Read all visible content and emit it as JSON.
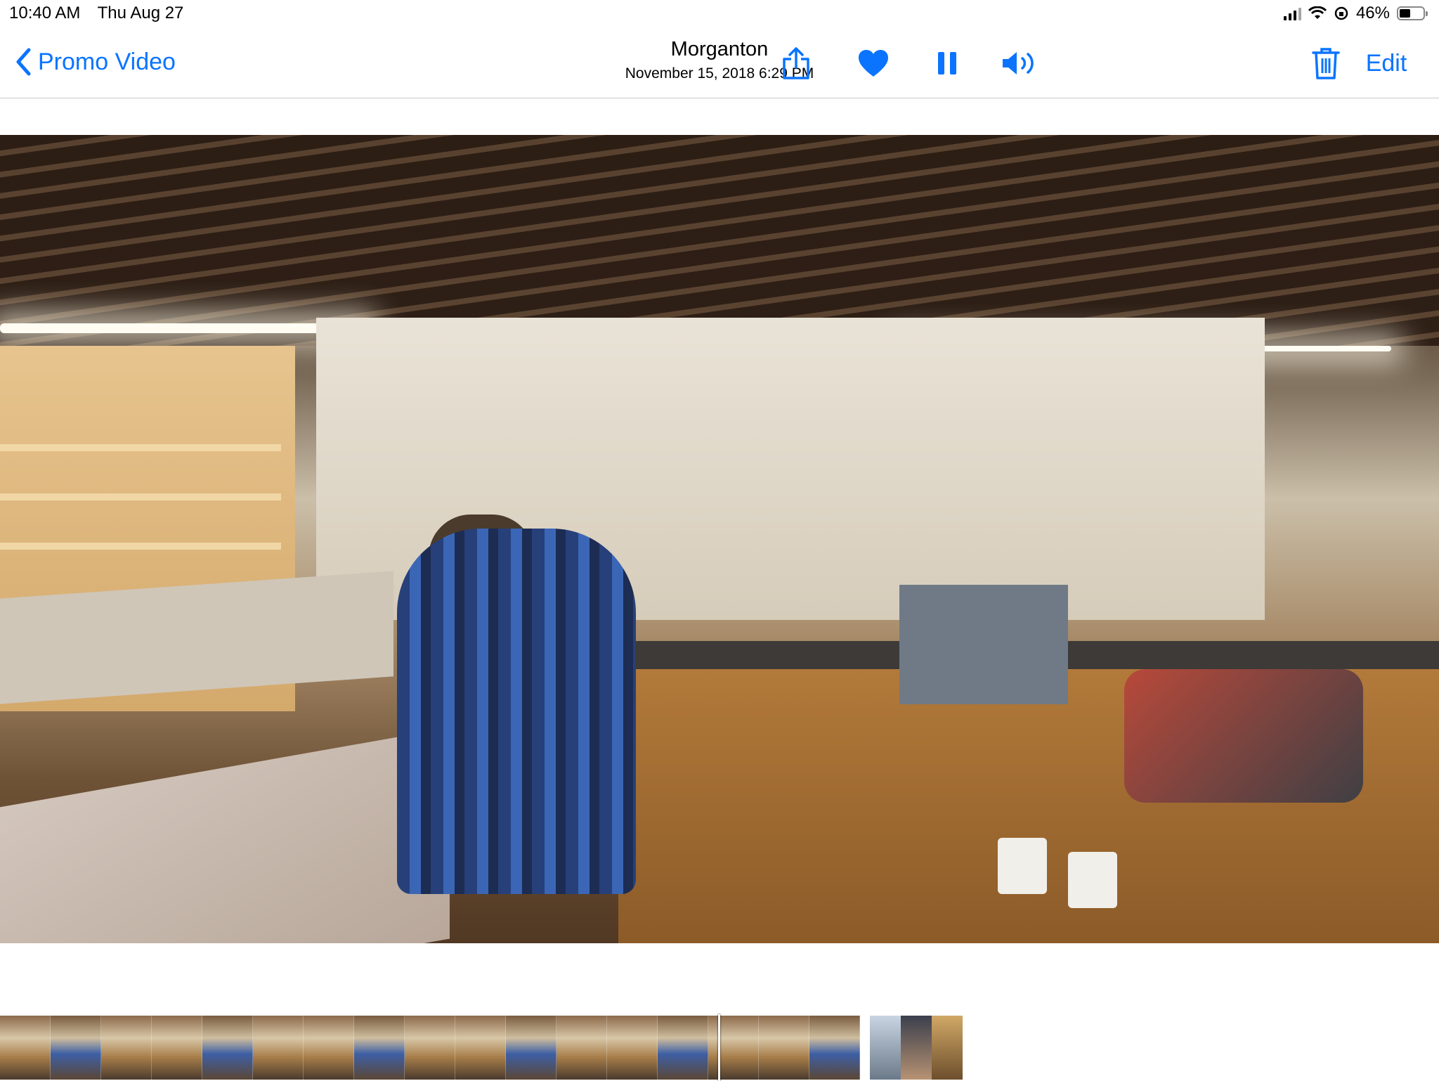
{
  "status_bar": {
    "time": "10:40 AM",
    "date": "Thu Aug 27",
    "battery_text": "46%",
    "battery_level": 0.46
  },
  "nav": {
    "back_label": "Promo Video",
    "title": "Morganton",
    "subtitle": "November 15, 2018  6:29 PM",
    "edit_label": "Edit",
    "accent_color": "#0a74ff",
    "icons": [
      "share-icon",
      "heart-icon",
      "pause-icon",
      "speaker-icon",
      "trash-icon"
    ]
  },
  "media": {
    "kind": "video-frame",
    "scene": "woodworking shop"
  },
  "filmstrip": {
    "icons": [
      "video-frames",
      "photo-thumbnails"
    ]
  }
}
